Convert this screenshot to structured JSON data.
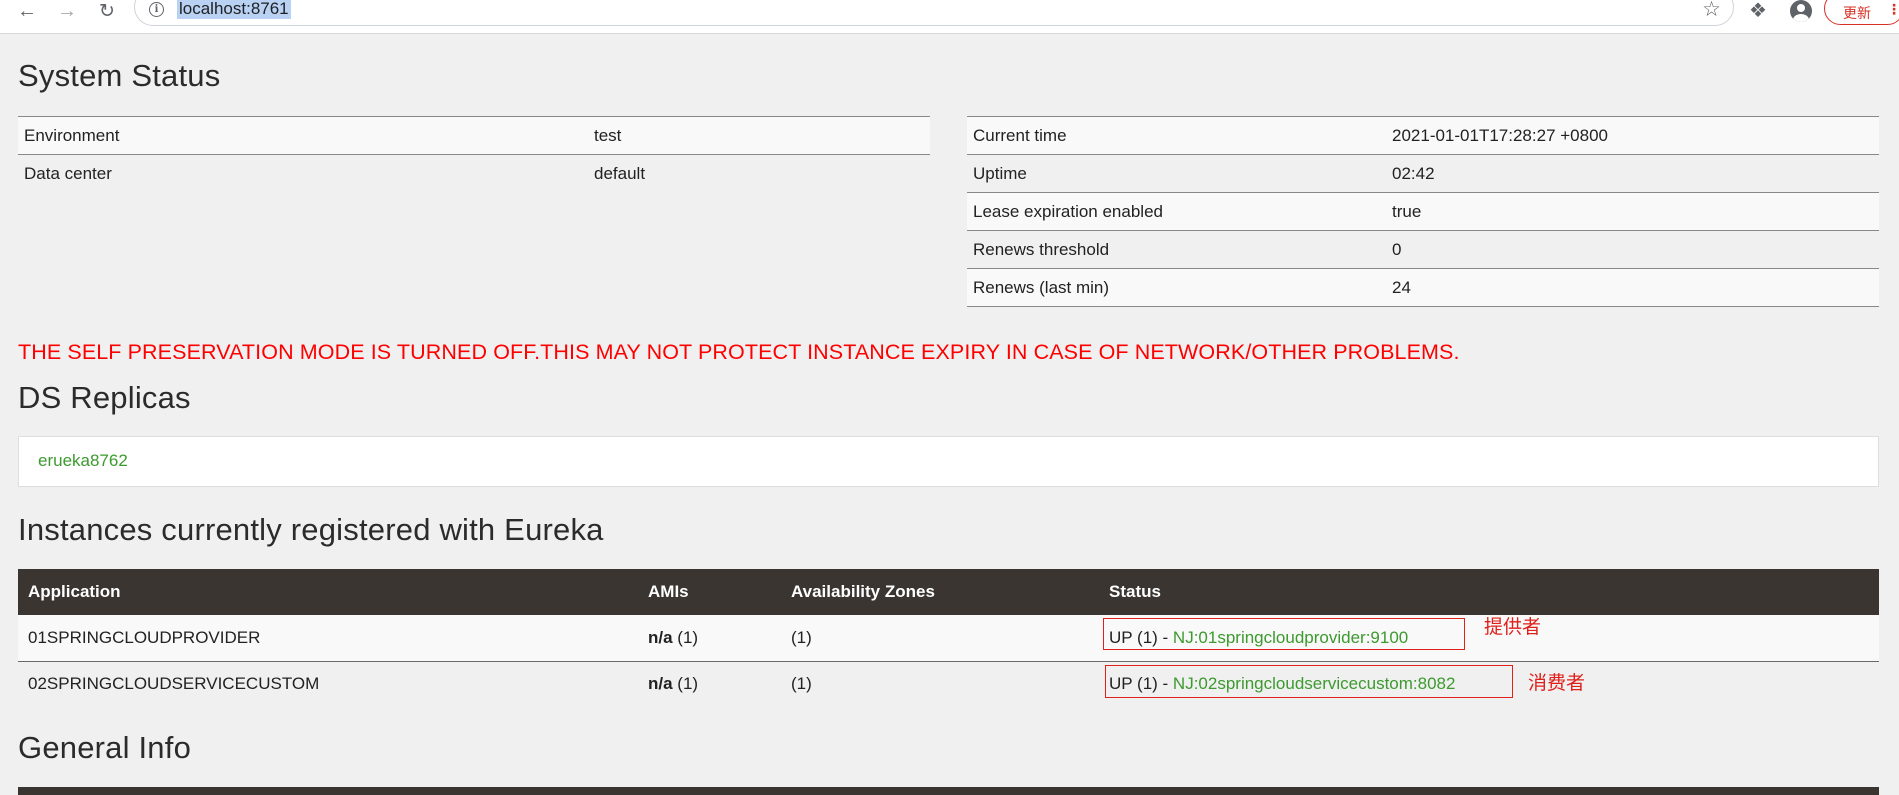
{
  "browser": {
    "url": "localhost:8761",
    "update_label": "更新"
  },
  "system_status": {
    "title": "System Status",
    "env_rows": [
      {
        "key": "Environment",
        "value": "test"
      },
      {
        "key": "Data center",
        "value": "default"
      }
    ],
    "time_rows": [
      {
        "key": "Current time",
        "value": "2021-01-01T17:28:27 +0800"
      },
      {
        "key": "Uptime",
        "value": "02:42"
      },
      {
        "key": "Lease expiration enabled",
        "value": "true"
      },
      {
        "key": "Renews threshold",
        "value": "0"
      },
      {
        "key": "Renews (last min)",
        "value": "24"
      }
    ]
  },
  "warning": "THE SELF PRESERVATION MODE IS TURNED OFF.THIS MAY NOT PROTECT INSTANCE EXPIRY IN CASE OF NETWORK/OTHER PROBLEMS.",
  "replicas": {
    "title": "DS Replicas",
    "link": "erueka8762"
  },
  "instances": {
    "title": "Instances currently registered with Eureka",
    "headers": [
      "Application",
      "AMIs",
      "Availability Zones",
      "Status"
    ],
    "rows": [
      {
        "app": "01SPRINGCLOUDPROVIDER",
        "ami_bold": "n/a",
        "ami_count": " (1)",
        "zones": "(1)",
        "status_prefix": "UP (1) - ",
        "status_link": "NJ:01springcloudprovider:9100",
        "annotation": "提供者"
      },
      {
        "app": "02SPRINGCLOUDSERVICECUSTOM",
        "ami_bold": "n/a",
        "ami_count": " (1)",
        "zones": "(1)",
        "status_prefix": "UP (1) - ",
        "status_link": "NJ:02springcloudservicecustom:8082",
        "annotation": "消费者"
      }
    ]
  },
  "general_info": {
    "title": "General Info"
  },
  "colors": {
    "warning": "#ff0000",
    "link": "#3c9a2e",
    "table_header": "#3a3531",
    "annotation": "#e0201b"
  }
}
